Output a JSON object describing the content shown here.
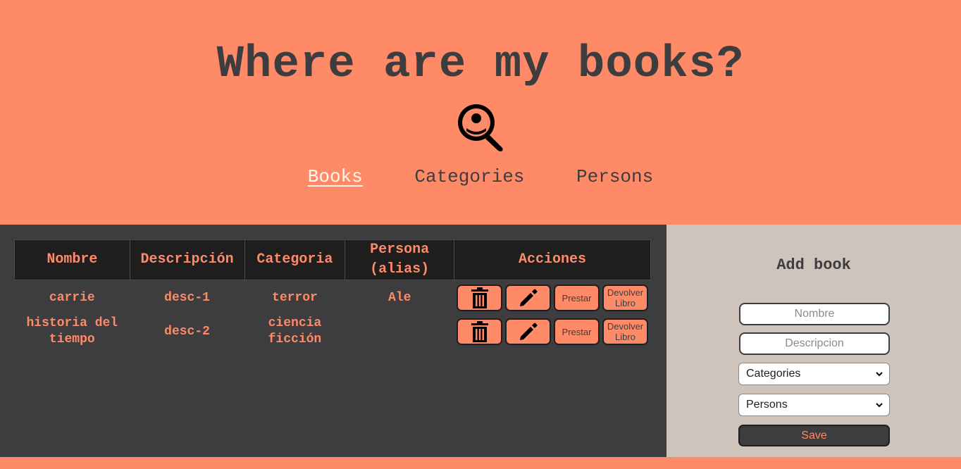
{
  "header": {
    "title": "Where are my books?",
    "logo_icon": "search-person-icon"
  },
  "nav": {
    "items": [
      {
        "label": "Books",
        "active": true
      },
      {
        "label": "Categories",
        "active": false
      },
      {
        "label": "Persons",
        "active": false
      }
    ]
  },
  "table": {
    "columns": [
      "Nombre",
      "Descripción",
      "Categoria",
      "Persona (alias)",
      "Acciones"
    ],
    "rows": [
      {
        "nombre": "carrie",
        "descripcion": "desc-1",
        "categoria": "terror",
        "persona": "Ale"
      },
      {
        "nombre": "historia del tiempo",
        "descripcion": "desc-2",
        "categoria": "ciencia ficción",
        "persona": ""
      }
    ],
    "actions": {
      "delete_icon": "trash-icon",
      "edit_icon": "pencil-icon",
      "lend_label": "Prestar",
      "return_label": "Devolver Libro"
    }
  },
  "form": {
    "title": "Add book",
    "nombre_placeholder": "Nombre",
    "descripcion_placeholder": "Descripcion",
    "categories_value": "Categories",
    "persons_value": "Persons",
    "save_label": "Save"
  },
  "colors": {
    "accent": "#ff8a68",
    "dark": "#3d3d3f",
    "panel": "#cfc4bb"
  }
}
